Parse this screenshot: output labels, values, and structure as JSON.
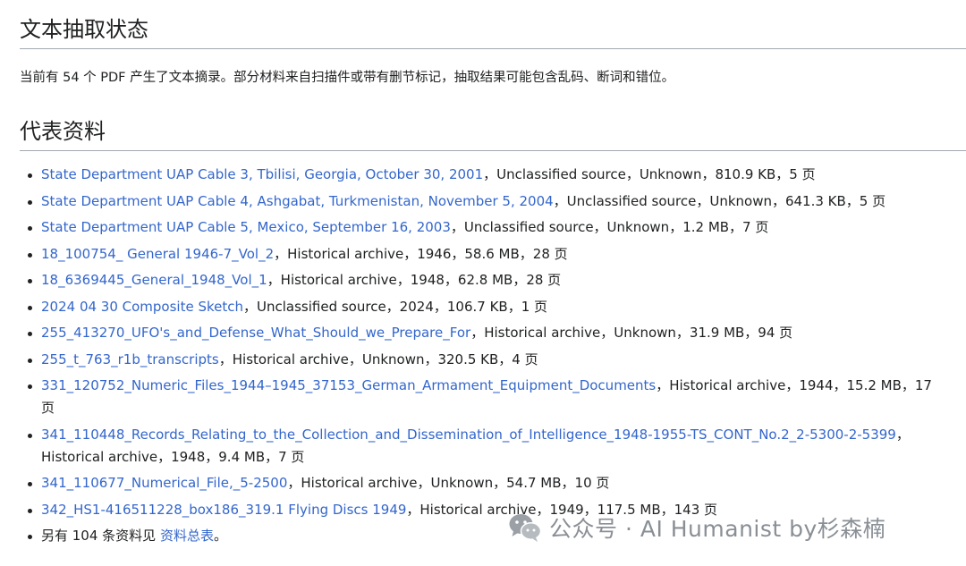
{
  "sections": {
    "status_heading": "文本抽取状态",
    "status_text": "当前有 54 个 PDF 产生了文本摘录。部分材料来自扫描件或带有删节标记，抽取结果可能包含乱码、断词和错位。",
    "reps_heading": "代表资料"
  },
  "documents": [
    {
      "title": "State Department UAP Cable 3, Tbilisi, Georgia, October 30, 2001",
      "meta": "，Unclassified source，Unknown，810.9 KB，5 页"
    },
    {
      "title": "State Department UAP Cable 4, Ashgabat, Turkmenistan, November 5, 2004",
      "meta": "，Unclassified source，Unknown，641.3 KB，5 页"
    },
    {
      "title": "State Department UAP Cable 5, Mexico, September 16, 2003",
      "meta": "，Unclassified source，Unknown，1.2 MB，7 页"
    },
    {
      "title": "18_100754_ General 1946-7_Vol_2",
      "meta": "，Historical archive，1946，58.6 MB，28 页"
    },
    {
      "title": "18_6369445_General_1948_Vol_1",
      "meta": "，Historical archive，1948，62.8 MB，28 页"
    },
    {
      "title": "2024 04 30 Composite Sketch",
      "meta": "，Unclassified source，2024，106.7 KB，1 页"
    },
    {
      "title": "255_413270_UFO's_and_Defense_What_Should_we_Prepare_For",
      "meta": "，Historical archive，Unknown，31.9 MB，94 页"
    },
    {
      "title": "255_t_763_r1b_transcripts",
      "meta": "，Historical archive，Unknown，320.5 KB，4 页"
    },
    {
      "title": "331_120752_Numeric_Files_1944–1945_37153_German_Armament_Equipment_Documents",
      "meta": "，Historical archive，1944，15.2 MB，17 页"
    },
    {
      "title": "341_110448_Records_Relating_to_the_Collection_and_Dissemination_of_Intelligence_1948-1955-TS_CONT_No.2_2-5300-2-5399",
      "meta": "，Historical archive，1948，9.4 MB，7 页"
    },
    {
      "title": "341_110677_Numerical_File,_5-2500",
      "meta": "，Historical archive，Unknown，54.7 MB，10 页"
    },
    {
      "title": "342_HS1-416511228_box186_319.1 Flying Discs 1949",
      "meta": "，Historical archive，1949，117.5 MB，143 页"
    }
  ],
  "more": {
    "prefix": "另有 104 条资料见 ",
    "link": "资料总表",
    "suffix": "。"
  },
  "watermark": {
    "text": "公众号 · AI Humanist by杉森楠",
    "icon": "wechat-icon",
    "color": "#8a8f96"
  },
  "colors": {
    "link": "#3366cc",
    "text": "#202122",
    "rule": "#a2a9b1"
  }
}
